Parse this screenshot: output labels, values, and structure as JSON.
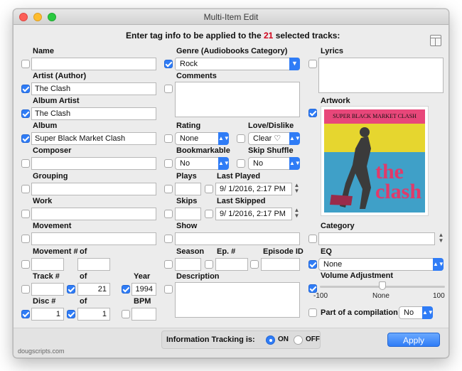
{
  "window": {
    "title": "Multi-Item Edit"
  },
  "header": {
    "prefix": "Enter tag info to be applied to the ",
    "count": "21",
    "suffix": " selected tracks:"
  },
  "left": {
    "name": {
      "label": "Name",
      "value": ""
    },
    "artist": {
      "label": "Artist (Author)",
      "value": "The Clash"
    },
    "album_artist": {
      "label": "Album Artist",
      "value": "The Clash"
    },
    "album": {
      "label": "Album",
      "value": "Super Black Market Clash"
    },
    "composer": {
      "label": "Composer",
      "value": ""
    },
    "grouping": {
      "label": "Grouping",
      "value": ""
    },
    "work": {
      "label": "Work",
      "value": ""
    },
    "movement": {
      "label": "Movement",
      "value": ""
    },
    "movement_num": {
      "label": "Movement #",
      "of_label": "of",
      "value": "",
      "of_value": ""
    },
    "track_num": {
      "label": "Track #",
      "of_label": "of",
      "value": "",
      "of_value": "21"
    },
    "year": {
      "label": "Year",
      "value": "1994"
    },
    "disc_num": {
      "label": "Disc #",
      "of_label": "of",
      "value": "1",
      "of_value": "1"
    },
    "bpm": {
      "label": "BPM",
      "value": ""
    }
  },
  "middle": {
    "genre": {
      "label": "Genre (Audiobooks Category)",
      "value": "Rock"
    },
    "comments": {
      "label": "Comments"
    },
    "rating": {
      "label": "Rating",
      "value": "None"
    },
    "love": {
      "label": "Love/Dislike",
      "value": "Clear ♡"
    },
    "bookmarkable": {
      "label": "Bookmarkable",
      "value": "No"
    },
    "skip_shuffle": {
      "label": "Skip Shuffle",
      "value": "No"
    },
    "plays": {
      "label": "Plays",
      "value": ""
    },
    "last_played": {
      "label": "Last Played",
      "value": "9/  1/2016,  2:17 PM"
    },
    "skips": {
      "label": "Skips",
      "value": ""
    },
    "last_skipped": {
      "label": "Last Skipped",
      "value": "9/  1/2016,  2:17 PM"
    },
    "show": {
      "label": "Show",
      "value": ""
    },
    "season": {
      "label": "Season",
      "value": ""
    },
    "episode_num": {
      "label": "Ep. #",
      "value": ""
    },
    "episode_id": {
      "label": "Episode ID",
      "value": ""
    },
    "description": {
      "label": "Description"
    }
  },
  "right": {
    "lyrics": {
      "label": "Lyrics"
    },
    "artwork": {
      "label": "Artwork",
      "band_text": "SUPER BLACK MARKET CLASH",
      "art_text": "the clash"
    },
    "category": {
      "label": "Category",
      "value": ""
    },
    "eq": {
      "label": "EQ",
      "value": "None"
    },
    "volume": {
      "label": "Volume Adjustment",
      "min": "-100",
      "mid": "None",
      "max": "100",
      "level": 0.5
    },
    "compilation": {
      "label": "Part of a compilation",
      "value": "No"
    }
  },
  "bottom": {
    "tracking_label": "Information Tracking is:",
    "on_label": "ON",
    "off_label": "OFF",
    "apply_label": "Apply",
    "footer": "dougscripts.com"
  },
  "colors": {
    "accent": "#2f7cf6",
    "count": "#d0021b"
  }
}
